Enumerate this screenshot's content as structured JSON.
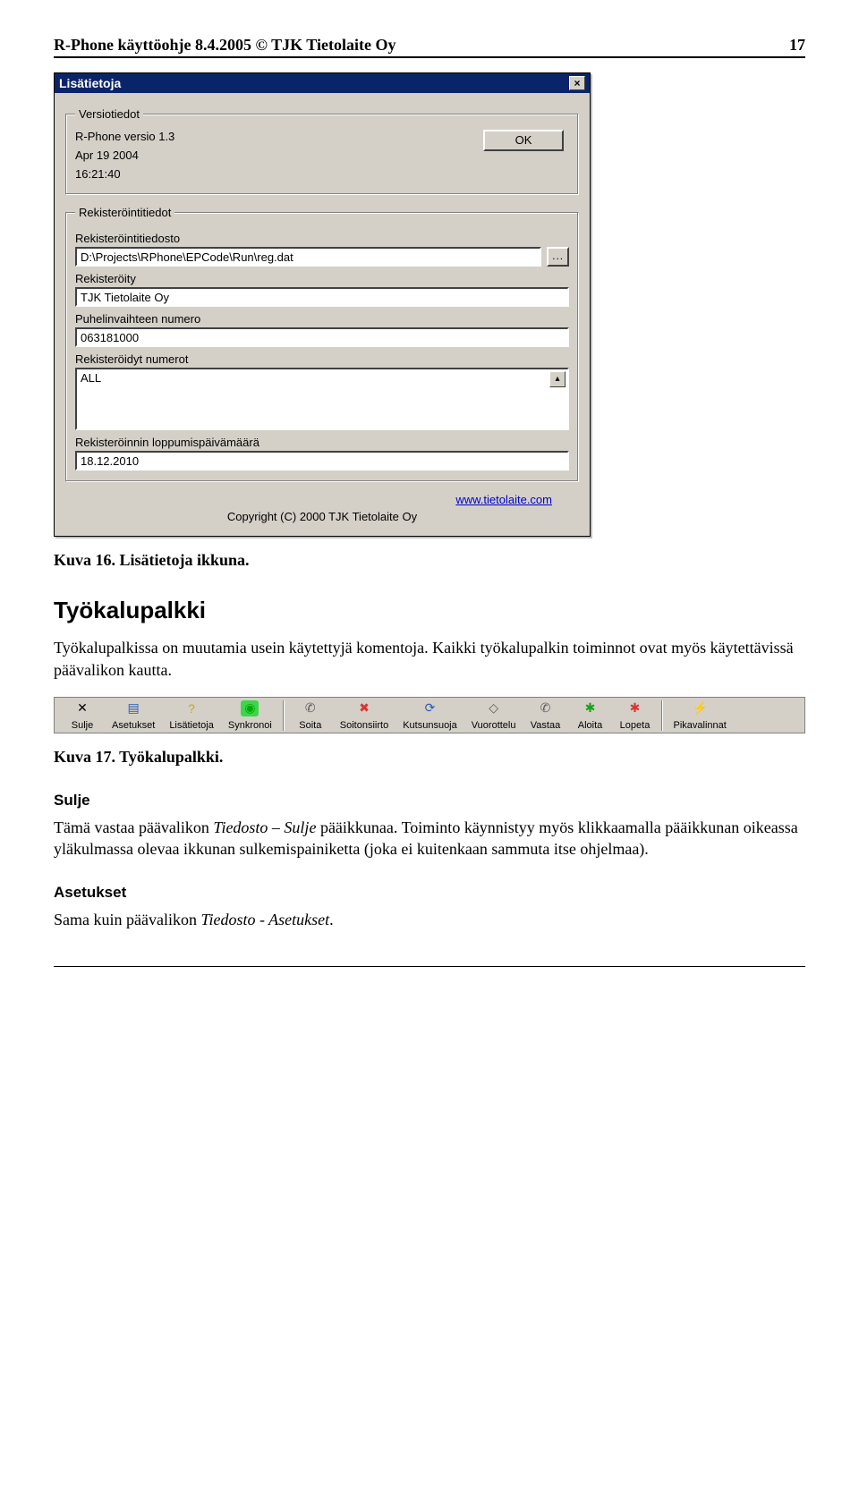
{
  "header": {
    "left": "R-Phone käyttöohje 8.4.2005 © TJK Tietolaite Oy",
    "right": "17"
  },
  "dialog": {
    "title": "Lisätietoja",
    "close_glyph": "×",
    "ok_label": "OK",
    "version": {
      "legend": "Versiotiedot",
      "line1": "R-Phone versio 1.3",
      "line2": "Apr 19 2004",
      "line3": "16:21:40"
    },
    "reg": {
      "legend": "Rekisteröintitiedot",
      "file_label": "Rekisteröintitiedosto",
      "file_value": "D:\\Projects\\RPhone\\EPCode\\Run\\reg.dat",
      "browse_glyph": "...",
      "registered_label": "Rekisteröity",
      "registered_value": "TJK Tietolaite Oy",
      "phone_label": "Puhelinvaihteen numero",
      "phone_value": "063181000",
      "numbers_label": "Rekisteröidyt numerot",
      "numbers_value": "ALL",
      "scroll_up_glyph": "▴",
      "expiry_label": "Rekisteröinnin loppumispäivämäärä",
      "expiry_value": "18.12.2010"
    },
    "link": "www.tietolaite.com",
    "copyright": "Copyright (C) 2000 TJK Tietolaite Oy"
  },
  "caption1": "Kuva 16. Lisätietoja ikkuna.",
  "section_title": "Työkalupalkki",
  "section_intro": "Työkalupalkissa on muutamia usein käytettyjä komentoja. Kaikki työkalupalkin toiminnot ovat myös käytettävissä päävalikon kautta.",
  "toolbar_items": [
    {
      "label": "Sulje",
      "glyph": "✕",
      "color": "#000"
    },
    {
      "label": "Asetukset",
      "glyph": "▤",
      "color": "#2a5db0"
    },
    {
      "label": "Lisätietoja",
      "glyph": "?",
      "color": "#c9a900"
    },
    {
      "label": "Synkronoi",
      "glyph": "◉",
      "color": "#0a0",
      "bg": "#3cd64a"
    }
  ],
  "toolbar_items2": [
    {
      "label": "Soita",
      "glyph": "✆",
      "color": "#5a5a5a"
    },
    {
      "label": "Soitonsiirto",
      "glyph": "✖",
      "color": "#d33"
    },
    {
      "label": "Kutsunsuoja",
      "glyph": "⟳",
      "color": "#2a5db0"
    },
    {
      "label": "Vuorottelu",
      "glyph": "◇",
      "color": "#5a5a5a"
    },
    {
      "label": "Vastaa",
      "glyph": "✆",
      "color": "#5a5a5a"
    },
    {
      "label": "Aloita",
      "glyph": "✱",
      "color": "#1aa01a"
    },
    {
      "label": "Lopeta",
      "glyph": "✱",
      "color": "#d33"
    }
  ],
  "toolbar_items3": [
    {
      "label": "Pikavalinnat",
      "glyph": "⚡",
      "color": "#c9a900"
    }
  ],
  "caption2": "Kuva 17. Työkalupalkki.",
  "sulje": {
    "heading": "Sulje",
    "text_pre": "Tämä vastaa päävalikon ",
    "text_em": "Tiedosto – Sulje",
    "text_post": " pääikkunaa. Toiminto käynnistyy myös klikkaamalla pääikkunan oikeassa yläkulmassa olevaa ikkunan sulkemispainiketta (joka ei kuitenkaan sammuta itse ohjelmaa)."
  },
  "asetukset": {
    "heading": "Asetukset",
    "text_pre": "Sama kuin päävalikon ",
    "text_em": "Tiedosto - Asetukset",
    "text_post": "."
  }
}
